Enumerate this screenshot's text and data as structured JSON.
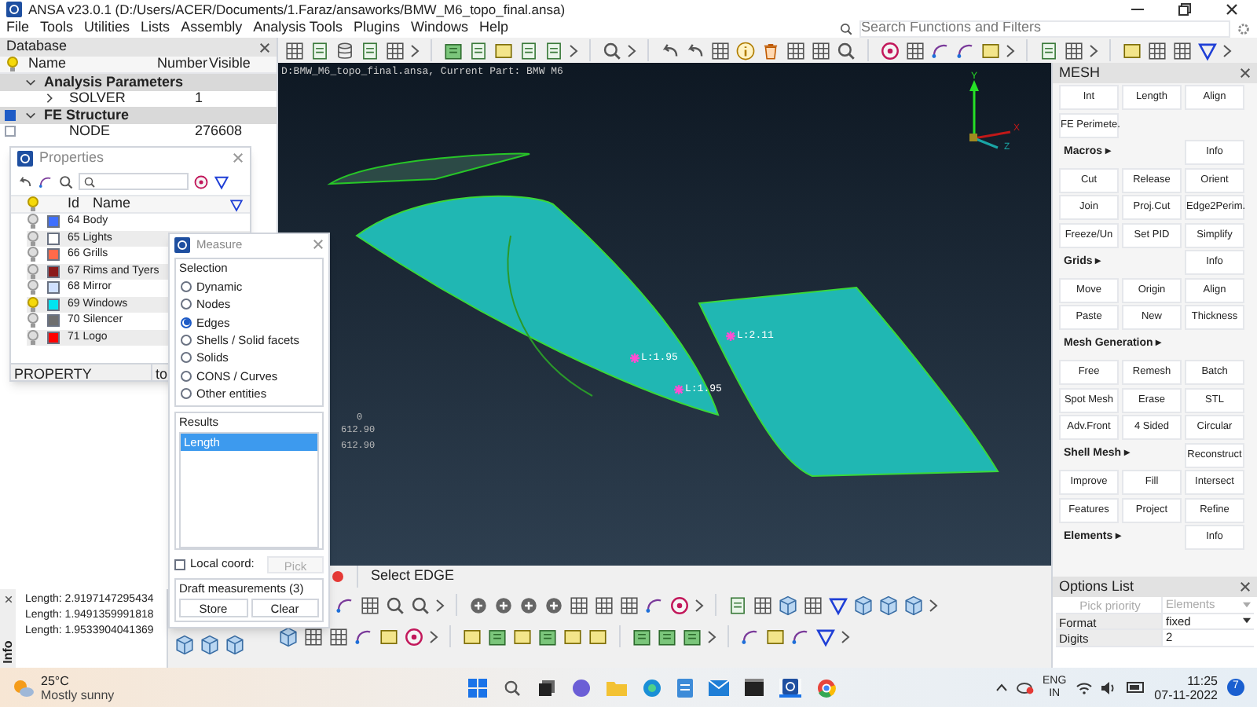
{
  "window": {
    "title": "ANSA v23.0.1 (D:/Users/ACER/Documents/1.Faraz/ansaworks/BMW_M6_topo_final.ansa)"
  },
  "menu": [
    "File",
    "Tools",
    "Utilities",
    "Lists",
    "Assembly",
    "Analysis Tools",
    "Plugins",
    "Windows",
    "Help"
  ],
  "search": {
    "placeholder": "Search Functions and Filters"
  },
  "database": {
    "title": "Database",
    "columns": [
      "Name",
      "Number",
      "Visible"
    ],
    "rows": [
      {
        "kind": "group",
        "name": "Analysis Parameters",
        "expanded": true
      },
      {
        "kind": "item",
        "name": "SOLVER",
        "number": "1",
        "expanded": false
      },
      {
        "kind": "group",
        "name": "FE Structure",
        "expanded": true,
        "checked": true
      },
      {
        "kind": "item",
        "name": "NODE",
        "number": "276608",
        "checked": false
      }
    ]
  },
  "properties": {
    "title": "Properties",
    "columns": [
      "Id",
      "Name"
    ],
    "rows": [
      {
        "label": "64 Body",
        "color": "#3f6fff",
        "visible": false
      },
      {
        "label": "65 Lights",
        "color": "#ffffff",
        "visible": false
      },
      {
        "label": "66 Grills",
        "color": "#ff6a4a",
        "visible": false
      },
      {
        "label": "67 Rims and Tyers",
        "color": "#8b1a1a",
        "visible": false
      },
      {
        "label": "68 Mirror",
        "color": "#cfe0ff",
        "visible": false
      },
      {
        "label": "69 Windows",
        "color": "#00e5f0",
        "visible": true
      },
      {
        "label": "70 Silencer",
        "color": "#6e6e6e",
        "visible": false
      },
      {
        "label": "71 Logo",
        "color": "#ff0000",
        "visible": false
      }
    ],
    "status": [
      "PROPERTY",
      "to"
    ]
  },
  "measure": {
    "title": "Measure",
    "selection_label": "Selection",
    "options": [
      {
        "label": "Dynamic",
        "selected": false
      },
      {
        "label": "Nodes",
        "selected": false
      },
      {
        "label": "Edges",
        "selected": true
      },
      {
        "label": "Shells / Solid facets",
        "selected": false
      },
      {
        "label": "Solids",
        "selected": false
      },
      {
        "label": "CONS / Curves",
        "selected": false
      },
      {
        "label": "Other entities",
        "selected": false
      }
    ],
    "results_label": "Results",
    "results": [
      {
        "label": "Length",
        "selected": true
      }
    ],
    "local_coord": {
      "label": "Local coord:",
      "checked": false
    },
    "pick": {
      "label": "Pick",
      "disabled": true
    },
    "draft_label": "Draft measurements (3)",
    "buttons": [
      "Store",
      "Clear"
    ]
  },
  "viewport": {
    "header": "D:BMW_M6_topo_final.ansa,  Current Part: BMW M6",
    "axes": [
      "Y",
      "X",
      "Z"
    ],
    "labels": [
      "L:1.95",
      "L:2.11",
      "L:1.95"
    ],
    "readouts": [
      "0",
      "612.90",
      "612.90"
    ]
  },
  "status": {
    "prompt": "Select EDGE"
  },
  "info": {
    "title": "Info",
    "lines": [
      "Length: 2.9197147295434",
      "Length: 1.9491359991818",
      "Length: 1.9533904041369"
    ]
  },
  "mesh": {
    "title": "MESH",
    "sections": [
      {
        "buttons": [
          "Int",
          "Length",
          "Align",
          "FE Perimete."
        ]
      },
      {
        "title": "Macros ▸",
        "side": "Info",
        "buttons": [
          "Cut",
          "Release",
          "Orient",
          "Join",
          "Proj.Cut",
          "Edge2Perim.",
          "Freeze/Un",
          "Set PID",
          "Simplify"
        ]
      },
      {
        "title": "Grids ▸",
        "side": "Info",
        "buttons": [
          "Move",
          "Origin",
          "Align",
          "Paste",
          "New",
          "Thickness"
        ]
      },
      {
        "title": "Mesh Generation ▸",
        "buttons": [
          "Free",
          "Remesh",
          "Batch",
          "Spot Mesh",
          "Erase",
          "STL",
          "Adv.Front",
          "4 Sided",
          "Circular"
        ]
      },
      {
        "title": "Shell Mesh ▸",
        "side": "Reconstruct",
        "buttons": [
          "Improve",
          "Fill",
          "Intersect",
          "Features",
          "Project",
          "Refine"
        ]
      },
      {
        "title": "Elements ▸",
        "side": "Info"
      }
    ]
  },
  "options_list": {
    "title": "Options List",
    "rows": [
      {
        "name": "Pick priority",
        "value": "Elements",
        "disabled": true,
        "dropdown": true
      },
      {
        "name": "Format",
        "value": "fixed",
        "disabled": false,
        "dropdown": true
      },
      {
        "name": "Digits",
        "value": "2",
        "disabled": false,
        "dropdown": false
      }
    ]
  },
  "taskbar": {
    "weather": {
      "temp": "25°C",
      "text": "Mostly sunny"
    },
    "language": [
      "ENG",
      "IN"
    ],
    "time": "11:25",
    "date": "07-11-2022",
    "notifications": "7"
  }
}
